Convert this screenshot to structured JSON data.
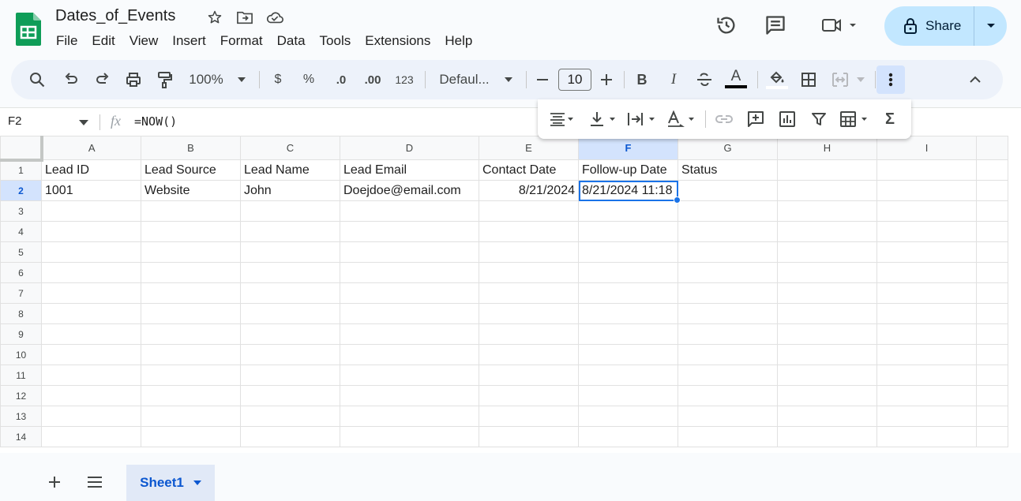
{
  "document": {
    "title": "Dates_of_Events"
  },
  "menu": [
    "File",
    "Edit",
    "View",
    "Insert",
    "Format",
    "Data",
    "Tools",
    "Extensions",
    "Help"
  ],
  "share": {
    "label": "Share"
  },
  "toolbar": {
    "zoom": "100%",
    "currency": "$",
    "percent": "%",
    "decrease_decimal": ".0",
    "increase_decimal": ".00",
    "number_format": "123",
    "font": "Defaul...",
    "font_size": "10",
    "bold": "B",
    "italic": "I",
    "text_color_letter": "A",
    "sigma": "Σ"
  },
  "formula_bar": {
    "cell_ref": "F2",
    "fx": "fx",
    "formula": "=NOW()"
  },
  "grid": {
    "columns": [
      "A",
      "B",
      "C",
      "D",
      "E",
      "F",
      "G",
      "H",
      "I"
    ],
    "rows": [
      "1",
      "2",
      "3",
      "4",
      "5",
      "6",
      "7",
      "8",
      "9",
      "10",
      "11",
      "12",
      "13",
      "14"
    ],
    "cells": {
      "A1": "Lead ID",
      "B1": "Lead Source",
      "C1": "Lead Name",
      "D1": "Lead Email",
      "E1": "Contact Date",
      "F1": "Follow-up Date",
      "G1": "Status",
      "A2": "1001",
      "B2": "Website",
      "C2": "John",
      "D2": "Doejdoe@email.com",
      "E2": "8/21/2024",
      "F2": "8/21/2024 11:18"
    },
    "selected_cell": "F2"
  },
  "sheets": {
    "active": "Sheet1"
  },
  "colors": {
    "accent": "#0b57d0",
    "selection": "#1a73e8",
    "share_bg": "#c2e7ff",
    "logo": "#0f9d58"
  },
  "icons": [
    "star-icon",
    "move-icon",
    "cloud-icon",
    "history-icon",
    "comment-icon",
    "video-icon",
    "lock-icon",
    "search-icon",
    "undo-icon",
    "redo-icon",
    "print-icon",
    "paint-format-icon",
    "fill-color-icon",
    "borders-icon",
    "merge-icon",
    "more-vert-icon",
    "collapse-icon",
    "align-icon",
    "valign-icon",
    "wrap-icon",
    "rotate-icon",
    "link-icon",
    "add-comment-icon",
    "chart-icon",
    "filter-icon",
    "table-view-icon",
    "sum-icon",
    "add-sheet-icon",
    "all-sheets-icon"
  ]
}
